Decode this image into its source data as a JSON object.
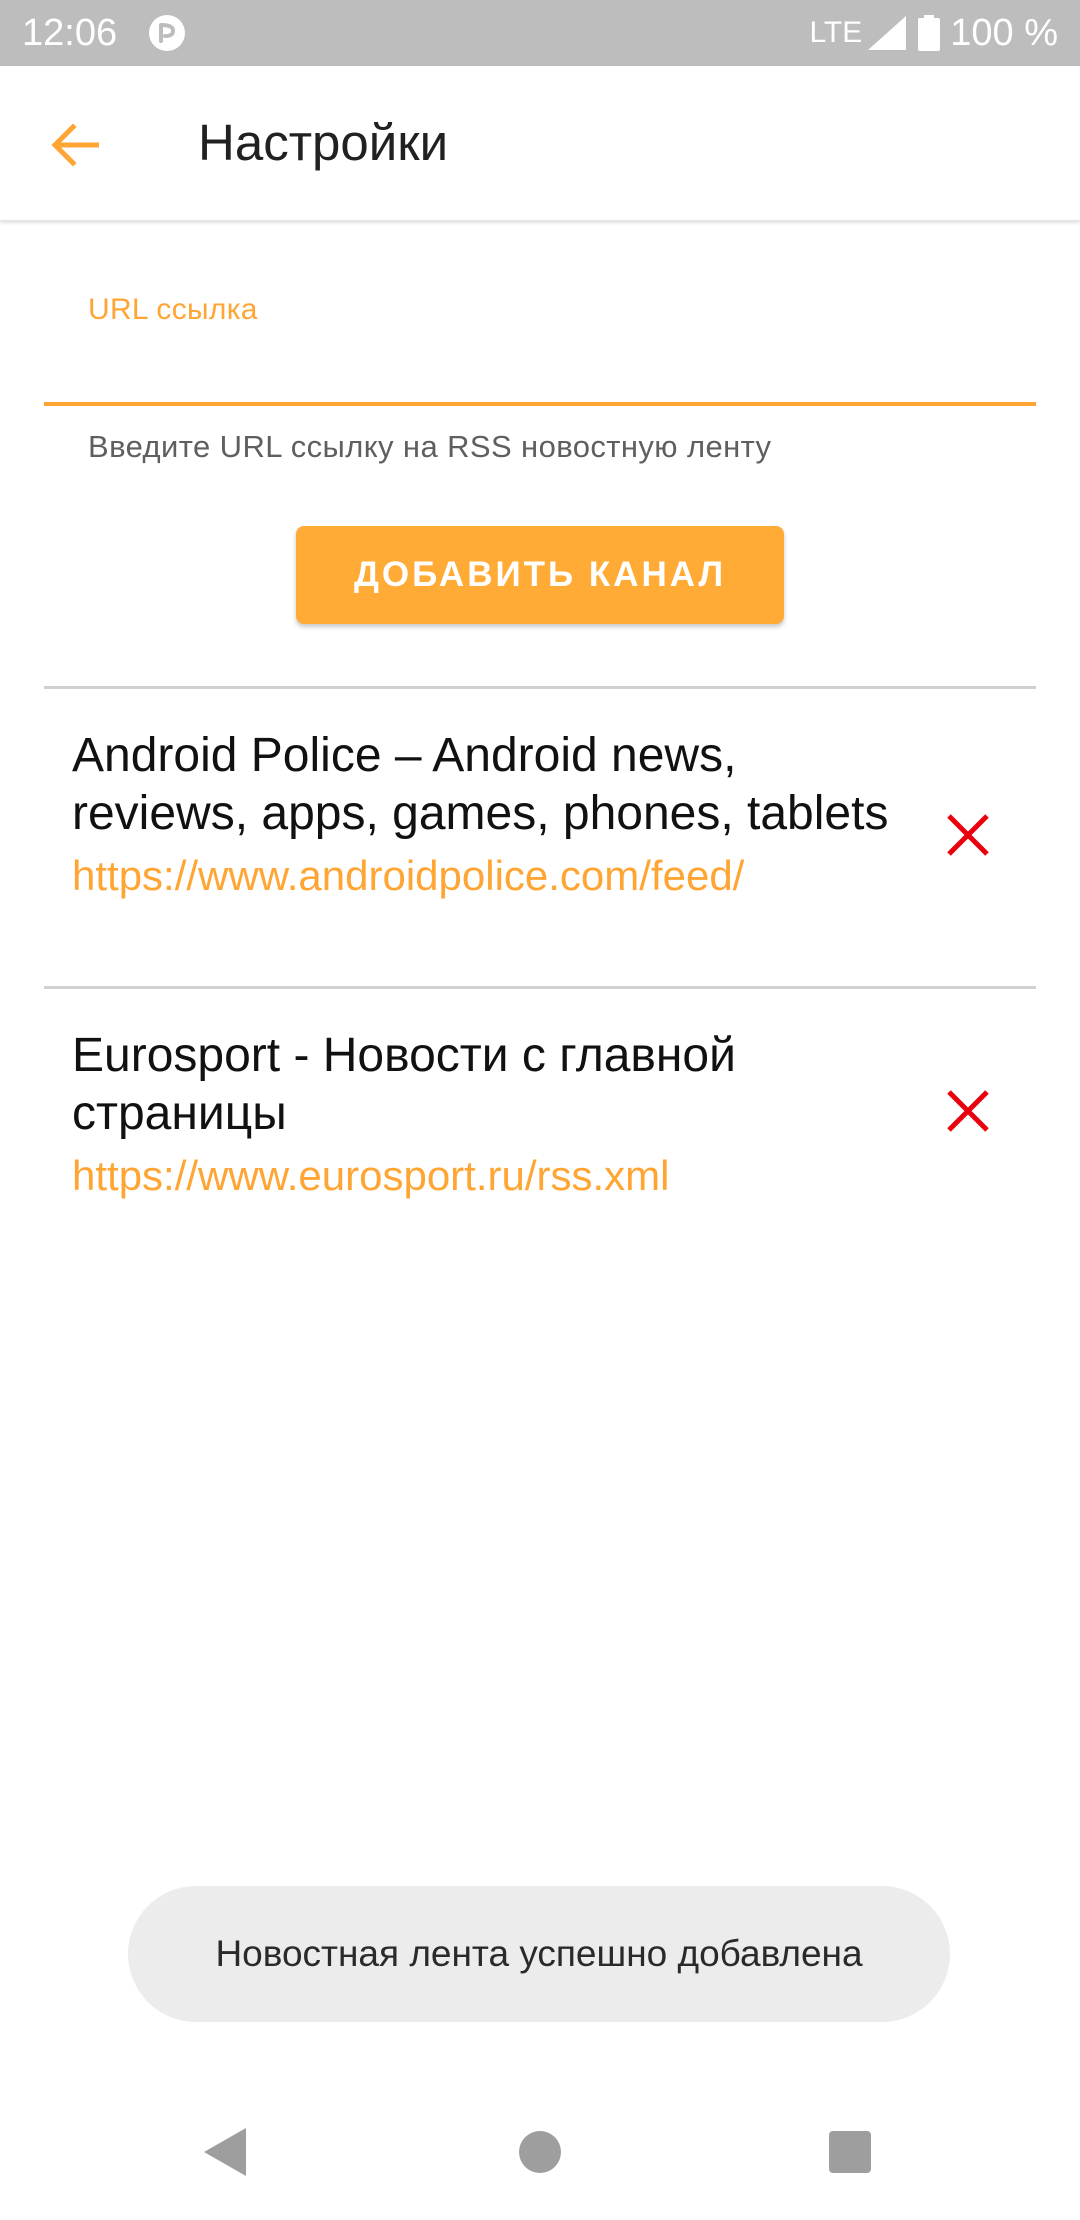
{
  "status_bar": {
    "time": "12:06",
    "app_icon": "app-notification-icon",
    "network": "LTE",
    "battery": "100 %"
  },
  "app_bar": {
    "back_icon": "arrow-back-icon",
    "title": "Настройки"
  },
  "url_field": {
    "label": "URL ссылка",
    "value": "",
    "helper": "Введите URL ссылку на RSS новостную ленту"
  },
  "add_button": {
    "label": "ДОБАВИТЬ КАНАЛ"
  },
  "feeds": [
    {
      "title": "Android Police – Android news, reviews, apps, games, phones, tablets",
      "url": "https://www.androidpolice.com/feed/",
      "delete_icon": "close-icon"
    },
    {
      "title": "Eurosport - Новости с главной страницы",
      "url": "https://www.eurosport.ru/rss.xml",
      "delete_icon": "close-icon"
    }
  ],
  "toast": {
    "message": "Новостная лента успешно добавлена"
  },
  "nav_bar": {
    "back_icon": "nav-back-icon",
    "home_icon": "nav-home-icon",
    "recents_icon": "nav-recents-icon"
  },
  "colors": {
    "accent": "#ffa534",
    "delete": "#e8000f",
    "status_bar": "#bdbdbd"
  }
}
